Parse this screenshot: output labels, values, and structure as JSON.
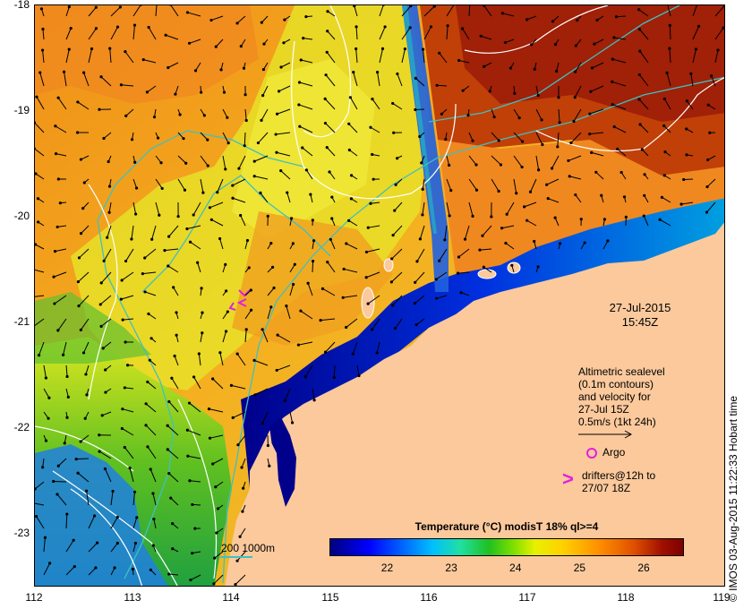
{
  "map": {
    "x_ticks": [
      "112",
      "113",
      "114",
      "115",
      "116",
      "117",
      "118",
      "119"
    ],
    "y_ticks": [
      "-18",
      "-19",
      "-20",
      "-21",
      "-22",
      "-23"
    ],
    "lon_range": [
      112,
      119
    ],
    "lat_range": [
      -23.5,
      -18
    ]
  },
  "annotations": {
    "date": "27-Jul-2015",
    "time": "15:45Z",
    "altimetric_lines": [
      "Altimetric sealevel",
      "(0.1m contours)",
      "and velocity for",
      "27-Jul 15Z",
      "0.5m/s (1kt 24h)"
    ],
    "argo_label": "Argo",
    "drifters_line1": "drifters@12h to",
    "drifters_line2": "27/07 18Z",
    "depth_legend": "200  1000m"
  },
  "colorbar": {
    "title": "Temperature (°C) modisT 18% ql>=4",
    "ticks": [
      "22",
      "23",
      "24",
      "25",
      "26"
    ],
    "tick_values": [
      22,
      23,
      24,
      25,
      26
    ],
    "range": [
      21.1,
      26.6
    ]
  },
  "credit": "© IMOS 03-Aug-2015 11:22:33 Hobart time",
  "colors": {
    "land": "#fbc99c",
    "drifters": "#e020e0",
    "bathymetry_contour": "#40c0c0",
    "sealevel_contour": "#ffffff",
    "arrows": "#000000"
  },
  "icons": [
    "argo-circle-icon",
    "drifter-chevron-icon",
    "velocity-arrow-icon"
  ]
}
